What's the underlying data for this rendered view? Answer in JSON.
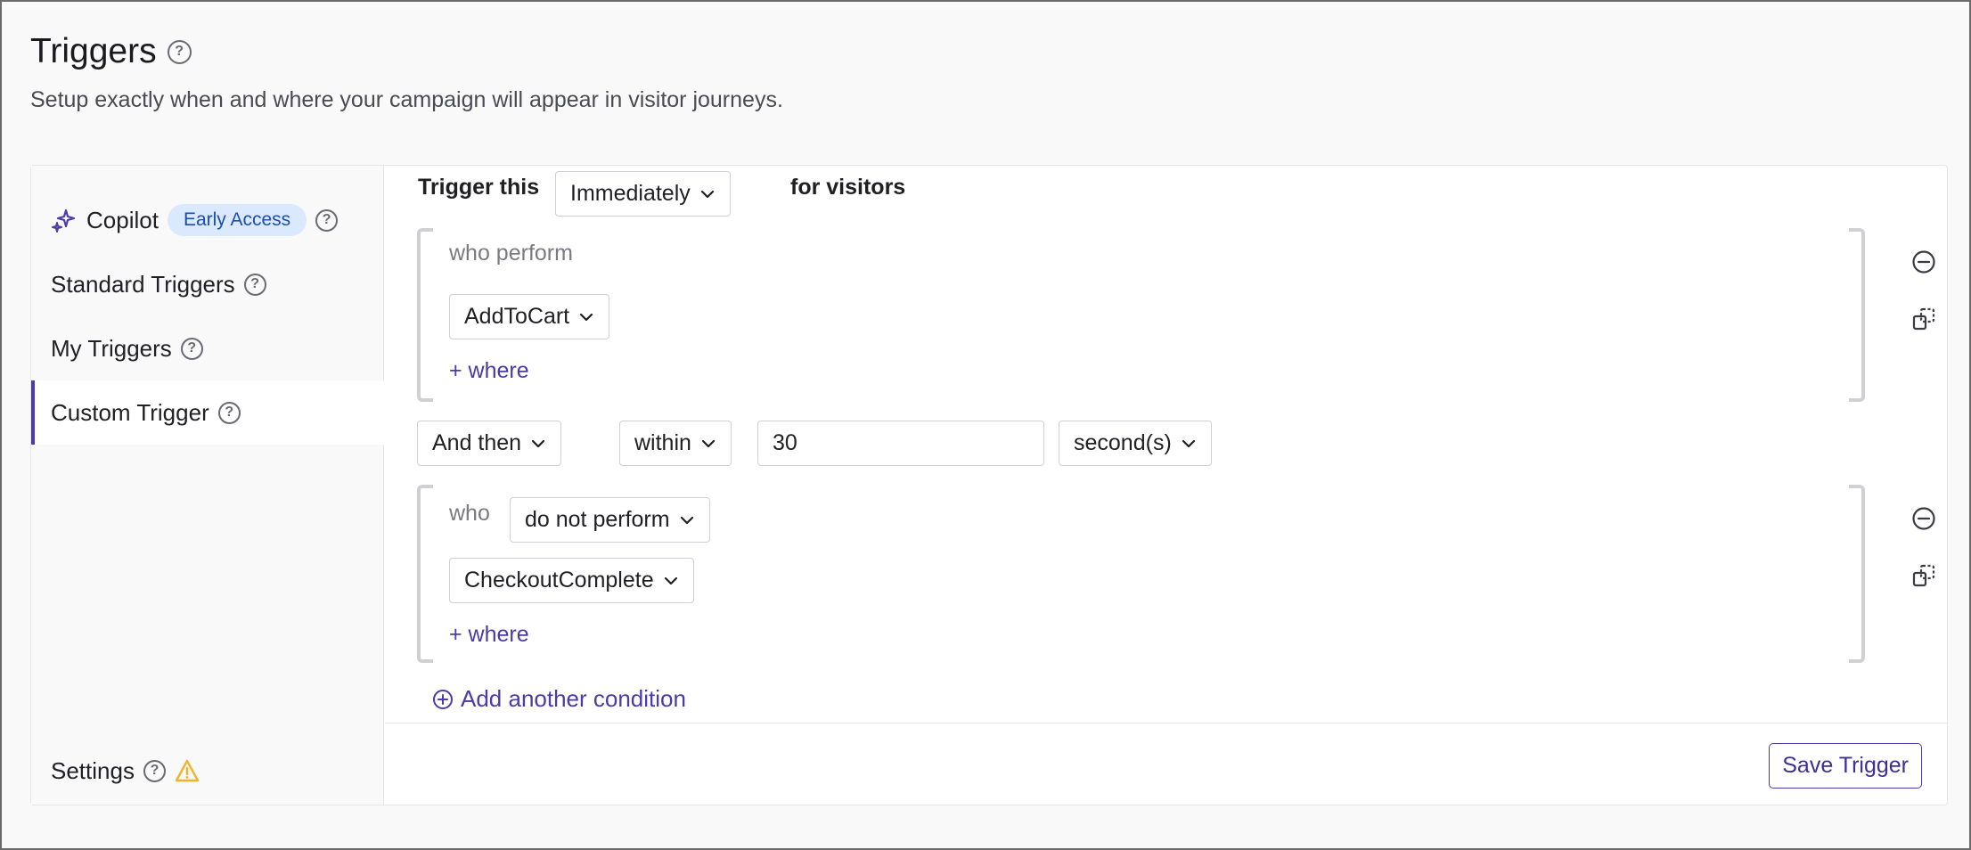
{
  "header": {
    "title": "Triggers",
    "subtitle": "Setup exactly when and where your campaign will appear in visitor journeys."
  },
  "sidebar": {
    "items": [
      {
        "label": "Copilot",
        "badge": "Early Access"
      },
      {
        "label": "Standard Triggers"
      },
      {
        "label": "My Triggers"
      },
      {
        "label": "Custom Trigger",
        "active": true
      }
    ],
    "settings_label": "Settings"
  },
  "trigger": {
    "prefix": "Trigger this",
    "timing": "Immediately",
    "suffix": "for visitors",
    "condition1": {
      "who_label": "who perform",
      "event": "AddToCart",
      "where_link": "+ where"
    },
    "connector": {
      "sequence": "And then",
      "window": "within",
      "amount": "30",
      "unit": "second(s)"
    },
    "condition2": {
      "who_label": "who",
      "action": "do not perform",
      "event": "CheckoutComplete",
      "where_link": "+ where"
    },
    "add_condition": "Add another condition"
  },
  "footer": {
    "save_label": "Save Trigger"
  },
  "colors": {
    "accent": "#4b3aa8",
    "badge_bg": "#dbe9ff",
    "warning": "#f0b429"
  }
}
